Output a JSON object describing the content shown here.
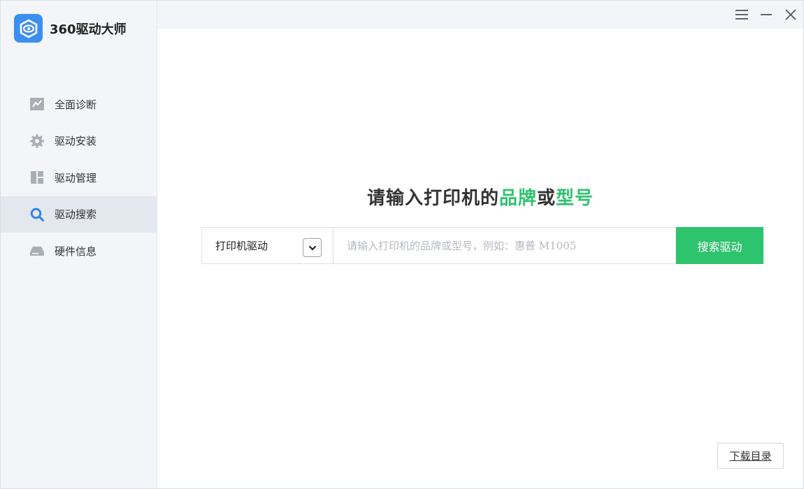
{
  "app": {
    "title": "360驱动大师",
    "accent_color": "#2ec36d",
    "logo_color": "#3b8ff0"
  },
  "sidebar": {
    "items": [
      {
        "label": "全面诊断",
        "icon": "chart-icon"
      },
      {
        "label": "驱动安装",
        "icon": "gear-icon"
      },
      {
        "label": "驱动管理",
        "icon": "grid-icon"
      },
      {
        "label": "驱动搜索",
        "icon": "search-icon",
        "active": true
      },
      {
        "label": "硬件信息",
        "icon": "drive-icon"
      }
    ]
  },
  "titlebar": {
    "icons": [
      "menu-icon",
      "minimize-icon",
      "close-icon"
    ]
  },
  "main": {
    "headline_prefix": "请输入打印机的",
    "headline_brand": "品牌",
    "headline_or": "或",
    "headline_model": "型号",
    "type_select": {
      "value": "打印机驱动"
    },
    "search": {
      "placeholder": "请输入打印机的品牌或型号，例如：惠普 M1005",
      "value": ""
    },
    "search_button": "搜索驱动",
    "download_button": "下载目录"
  }
}
